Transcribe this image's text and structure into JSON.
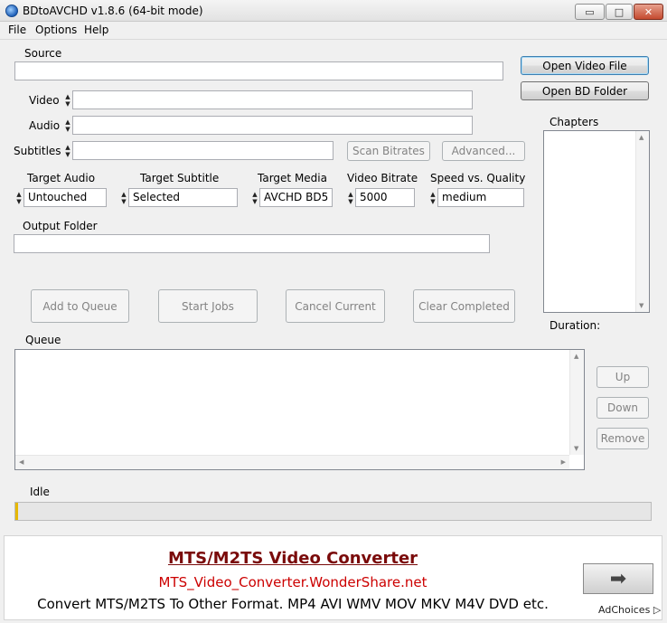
{
  "window": {
    "title": "BDtoAVCHD v1.8.6   (64-bit mode)",
    "minimize_glyph": "▭",
    "maximize_glyph": "□",
    "close_glyph": "✕"
  },
  "menu": {
    "file": "File",
    "options": "Options",
    "help": "Help"
  },
  "source": {
    "label": "Source",
    "value": "",
    "open_video_button": "Open Video File",
    "open_bd_button": "Open BD Folder"
  },
  "streams": {
    "video_label": "Video",
    "video_value": "",
    "audio_label": "Audio",
    "audio_value": "",
    "subtitles_label": "Subtitles",
    "subtitles_value": "",
    "scan_bitrates_button": "Scan Bitrates",
    "advanced_button": "Advanced..."
  },
  "chapters": {
    "label": "Chapters",
    "duration_label": "Duration:"
  },
  "targets": {
    "target_audio_label": "Target Audio",
    "target_audio_value": "Untouched",
    "target_subtitle_label": "Target Subtitle",
    "target_subtitle_value": "Selected",
    "target_media_label": "Target Media",
    "target_media_value": "AVCHD BD5",
    "video_bitrate_label": "Video Bitrate",
    "video_bitrate_value": "5000",
    "speed_quality_label": "Speed vs. Quality",
    "speed_quality_value": "medium"
  },
  "output": {
    "label": "Output Folder",
    "value": ""
  },
  "actions": {
    "add_to_queue": "Add to Queue",
    "start_jobs": "Start Jobs",
    "cancel_current": "Cancel Current",
    "clear_completed": "Clear Completed"
  },
  "queue": {
    "label": "Queue",
    "up_button": "Up",
    "down_button": "Down",
    "remove_button": "Remove"
  },
  "status": {
    "text": "Idle",
    "progress": 0
  },
  "ad": {
    "title": "MTS/M2TS Video Converter",
    "url": "MTS_Video_Converter.WonderShare.net",
    "description": "Convert MTS/M2TS To Other Format. MP4 AVI WMV MOV MKV M4V DVD etc.",
    "go_glyph": "➡",
    "adchoices": "AdChoices",
    "adchoices_glyph": "▷"
  },
  "colors": {
    "window_bg": "#f0f0f0",
    "ad_title": "#7a0a0a",
    "ad_url": "#cc0000",
    "progress_marker": "#e6b800"
  }
}
